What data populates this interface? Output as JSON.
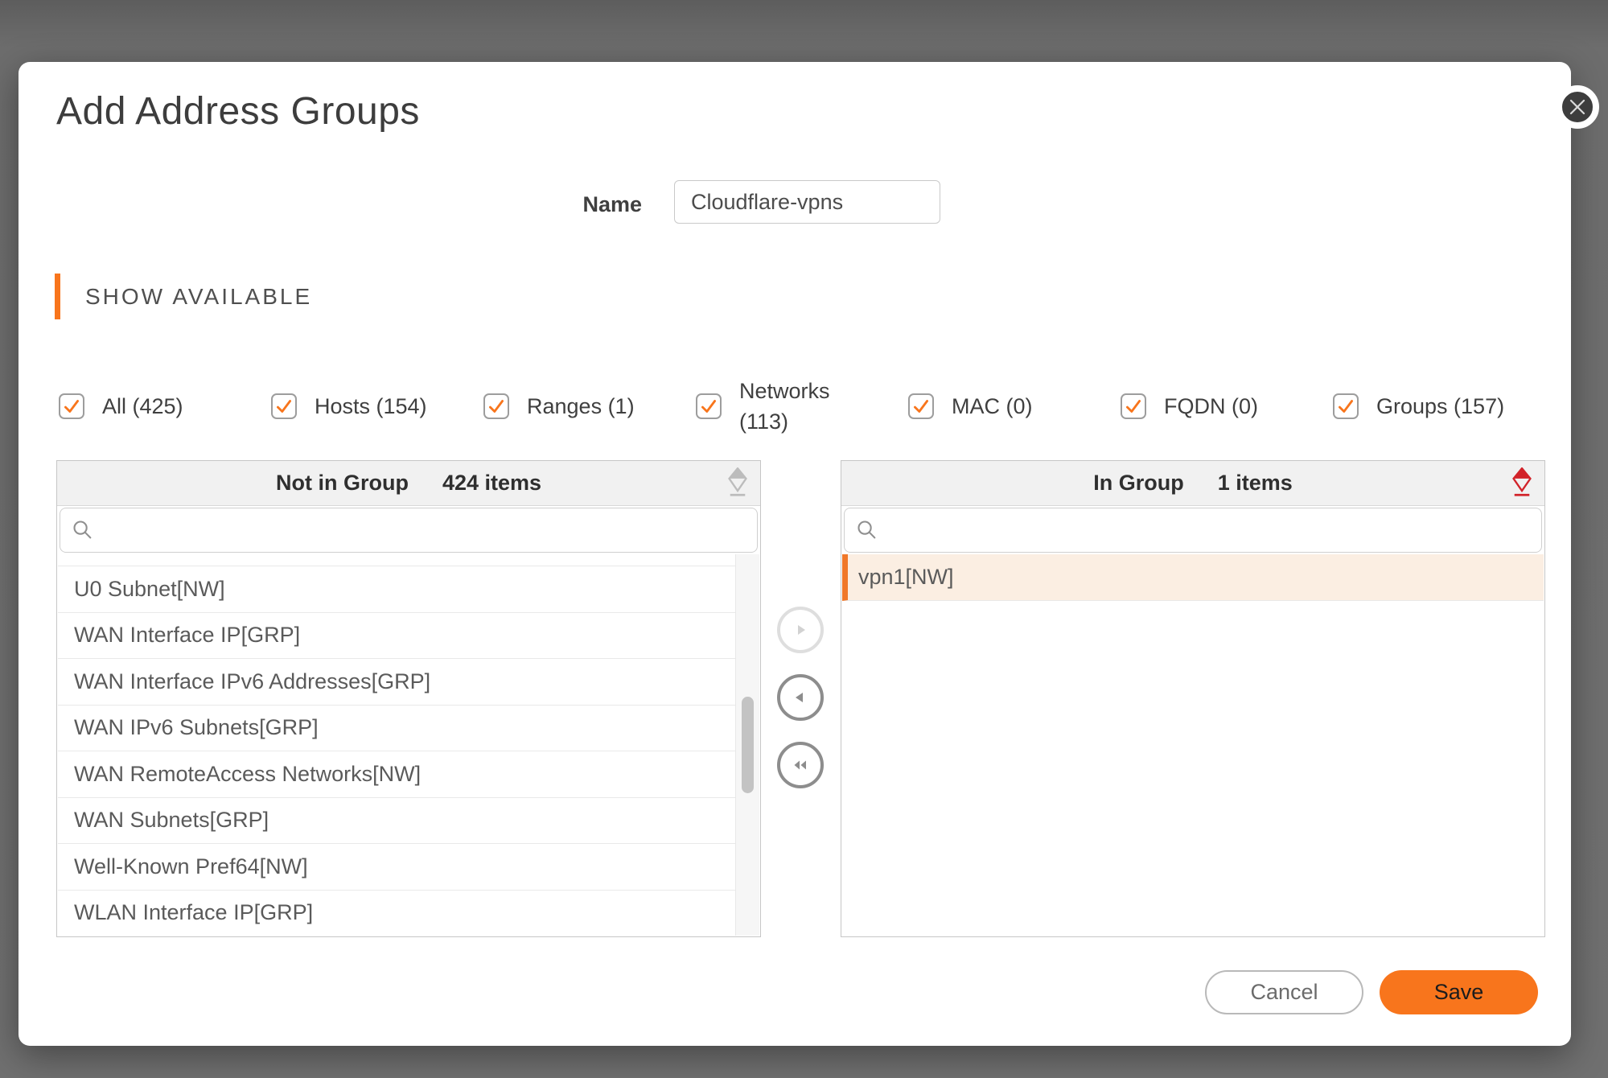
{
  "modal": {
    "title": "Add Address Groups"
  },
  "name_field": {
    "label": "Name",
    "value": "Cloudflare-vpns"
  },
  "section": {
    "heading": "SHOW AVAILABLE"
  },
  "filters": [
    {
      "label": "All (425)",
      "checked": true
    },
    {
      "label": "Hosts (154)",
      "checked": true
    },
    {
      "label": "Ranges (1)",
      "checked": true
    },
    {
      "label": "Networks (113)",
      "checked": true
    },
    {
      "label": "MAC (0)",
      "checked": true
    },
    {
      "label": "FQDN (0)",
      "checked": true
    },
    {
      "label": "Groups (157)",
      "checked": true
    }
  ],
  "left_panel": {
    "title": "Not in Group",
    "count": "424 items",
    "search_placeholder": "",
    "items": [
      "U0 Subnet[NW]",
      "WAN Interface IP[GRP]",
      "WAN Interface IPv6 Addresses[GRP]",
      "WAN IPv6 Subnets[GRP]",
      "WAN RemoteAccess Networks[NW]",
      "WAN Subnets[GRP]",
      "Well-Known Pref64[NW]",
      "WLAN Interface IP[GRP]"
    ]
  },
  "right_panel": {
    "title": "In Group",
    "count": "1 items",
    "search_placeholder": "",
    "items": [
      {
        "label": "vpn1[NW]",
        "selected": true
      }
    ]
  },
  "footer": {
    "cancel_label": "Cancel",
    "save_label": "Save"
  },
  "colors": {
    "accent_orange": "#F8751C",
    "selected_row_bar": "#F0782A",
    "selected_row_bg": "#FBEEE2",
    "eraser_red": "#D2232A"
  }
}
